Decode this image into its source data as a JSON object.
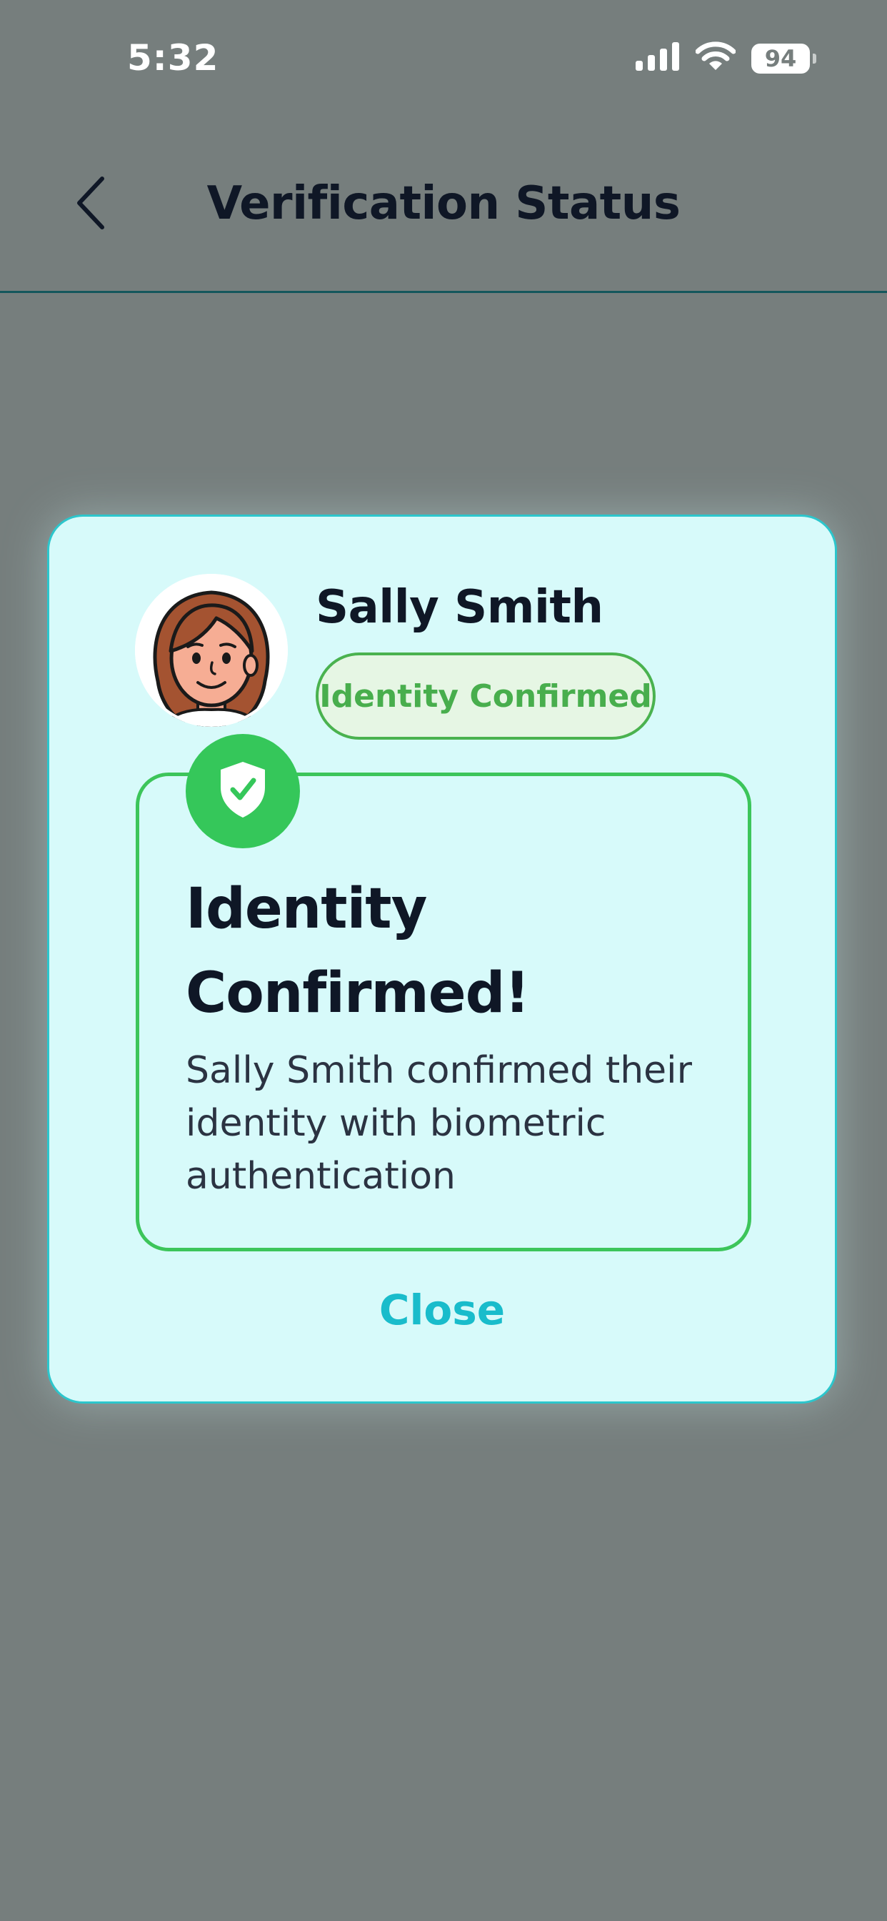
{
  "status_bar": {
    "time": "5:32",
    "battery_level": "94",
    "icons": [
      "cellular-signal-icon",
      "wifi-icon",
      "battery-icon"
    ]
  },
  "nav": {
    "back_icon": "chevron-left-icon",
    "title": "Verification Status"
  },
  "modal": {
    "user_name": "Sally Smith",
    "badge_label": "Identity Confirmed",
    "shield_icon": "shield-check-icon",
    "title": "Identity Confirmed!",
    "description": "Sally Smith confirmed their identity with biometric authentication",
    "close_label": "Close"
  },
  "colors": {
    "backdrop": "#767e7d",
    "card_background": "#d7fafa",
    "card_border": "#2cc6cc",
    "success_green": "#35c75a",
    "accent_teal": "#19bccb",
    "text_dark": "#0f1726"
  }
}
